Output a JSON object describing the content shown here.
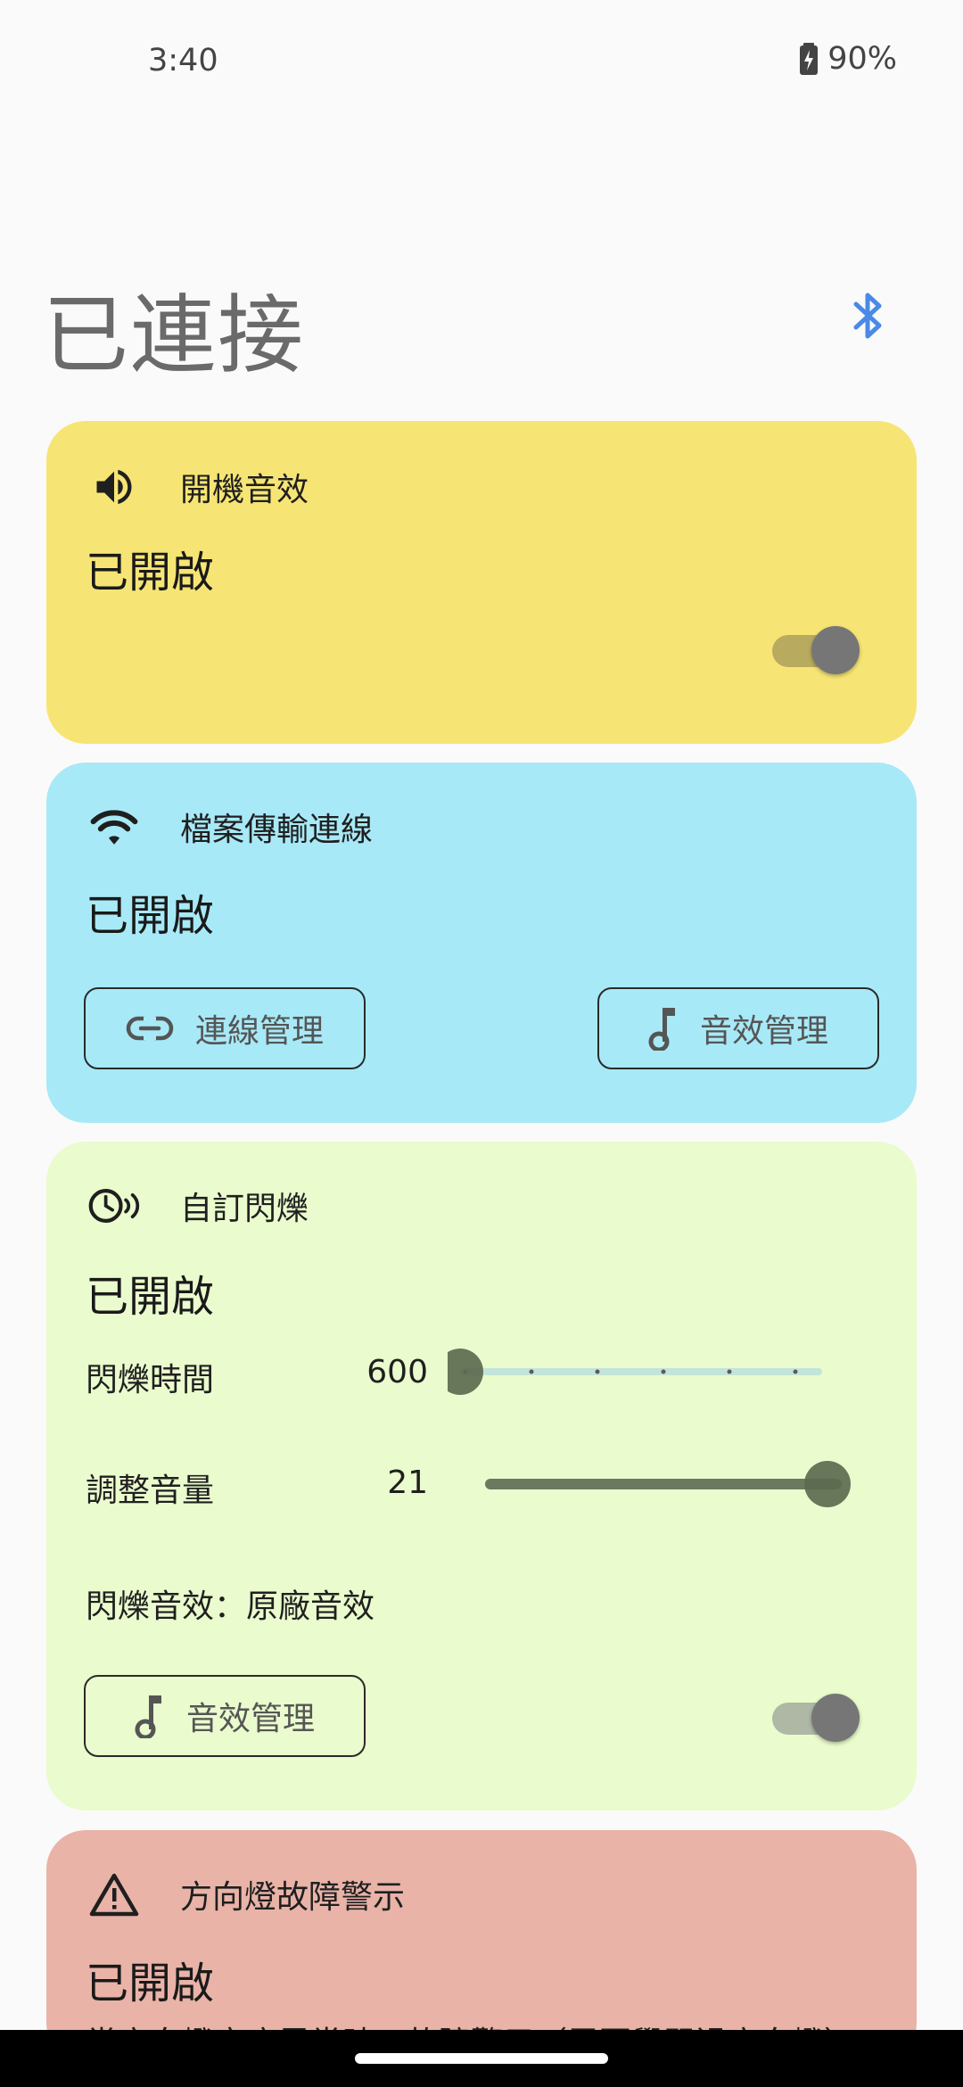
{
  "status_bar": {
    "time": "3:40",
    "battery": "90%"
  },
  "header": {
    "title": "已連接"
  },
  "cards": {
    "startup_sound": {
      "title": "開機音效",
      "status": "已開啟",
      "enabled": true,
      "color": "#f6e574"
    },
    "file_transfer": {
      "title": "檔案傳輸連線",
      "status": "已開啟",
      "connection_button": "連線管理",
      "sound_button": "音效管理",
      "color": "#a8e9f7"
    },
    "custom_flash": {
      "title": "自訂閃爍",
      "status": "已開啟",
      "flash_time_label": "閃爍時間",
      "flash_time_value": "600",
      "flash_time_level": 0.0,
      "volume_label": "調整音量",
      "volume_value": "21",
      "volume_level": 1.0,
      "flash_sound_text": "閃爍音效：原廠音效",
      "sound_button": "音效管理",
      "enabled": true,
      "color": "#eafbcd"
    },
    "turn_signal": {
      "title": "方向燈故障警示",
      "status": "已開啟",
      "description": "當方向燈亮度異常時，故障警示（需要學習過方向燈）",
      "color": "#e9b3a8"
    }
  },
  "icons": {
    "bluetooth": "bluetooth-icon",
    "volume": "volume-icon",
    "wifi": "wifi-icon",
    "link": "link-icon",
    "music": "music-note-icon",
    "alarm": "alarm-flash-icon",
    "warning": "warning-icon"
  },
  "accent": "#4a8ae6"
}
